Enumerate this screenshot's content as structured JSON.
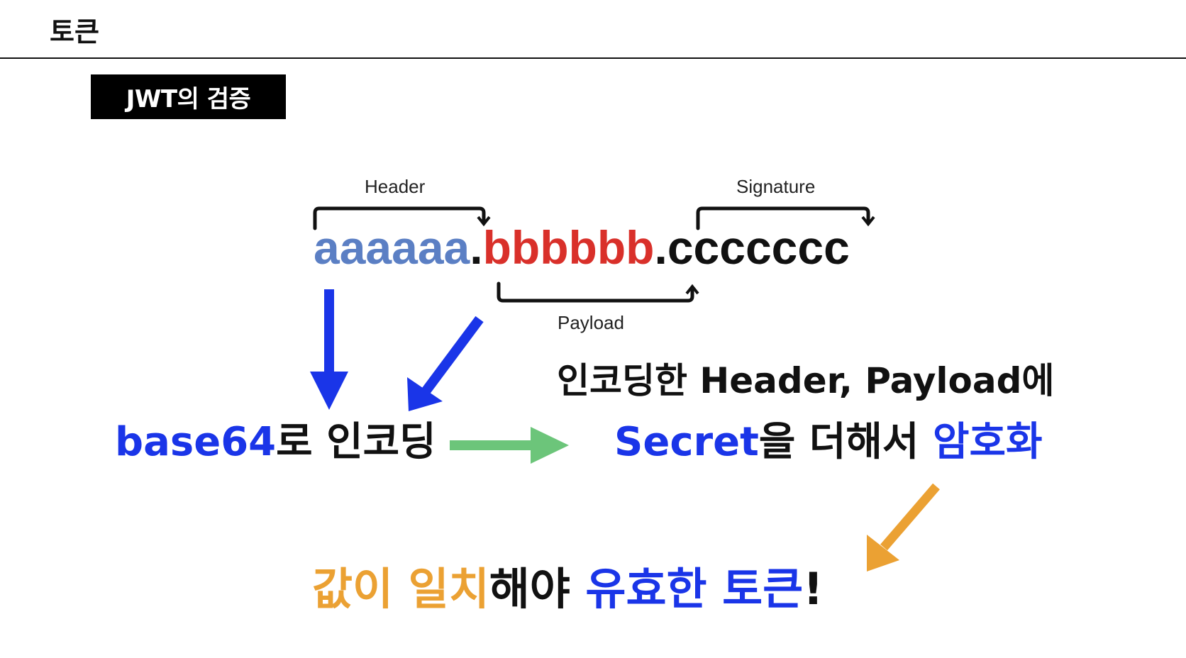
{
  "slide": {
    "title": "토큰",
    "section_badge": "JWT의 검증"
  },
  "jwt": {
    "header_label": "Header",
    "signature_label": "Signature",
    "payload_label": "Payload",
    "header_part": "aaaaaa",
    "payload_part": "bbbbbb",
    "signature_part": "ccccccc",
    "dot": "."
  },
  "encode": {
    "keyword": "base64",
    "rest": "로 인코딩"
  },
  "sign": {
    "line1": "인코딩한 Header, Payload에",
    "secret": "Secret",
    "mid": "을 더해서 ",
    "encrypt": "암호화"
  },
  "conclusion": {
    "part1": "값이 일치",
    "part2": "해야 ",
    "part3": "유효한 토큰",
    "part4": "!"
  },
  "colors": {
    "header_text": "#5b7fc4",
    "payload_text": "#d9302a",
    "highlight_blue": "#1a35e8",
    "highlight_orange": "#eba133",
    "arrow_green": "#6cc57a"
  }
}
